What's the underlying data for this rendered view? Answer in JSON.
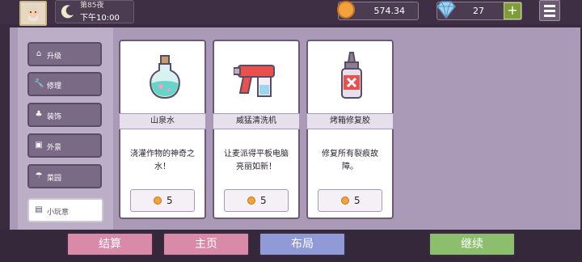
{
  "header": {
    "day_label": "第85夜",
    "time_label": "下午10:00",
    "coins": "574.34",
    "gems": "27",
    "plus_label": "+",
    "avatar_icon": "elder-portrait",
    "moon_icon": "crescent-moon",
    "menu_icon": "hamburger-menu"
  },
  "sidebar": {
    "items": [
      {
        "label": "升级",
        "icon": "home-icon"
      },
      {
        "label": "修理",
        "icon": "wrench-icon"
      },
      {
        "label": "装饰",
        "icon": "plant-icon"
      },
      {
        "label": "外景",
        "icon": "picture-icon"
      },
      {
        "label": "菜园",
        "icon": "watering-can-icon"
      },
      {
        "label": "小玩意",
        "icon": "toolbox-icon"
      }
    ],
    "active_index": 5
  },
  "cards": [
    {
      "name": "山泉水",
      "description": "浇灌作物的神奇之水！",
      "price": "5",
      "icon": "potion-bottle"
    },
    {
      "name": "威猛清洗机",
      "description": "让麦派得平板电脑亮丽如新！",
      "price": "5",
      "icon": "spray-gun"
    },
    {
      "name": "烤箱修复胶",
      "description": "修复所有裂痕故障。",
      "price": "5",
      "icon": "glue-bottle"
    }
  ],
  "buttons": {
    "checkout": "结算",
    "home": "主页",
    "layout": "布局",
    "continue": "继续"
  },
  "colors": {
    "checkout_bg": "#d98aa6",
    "home_bg": "#d98aa6",
    "layout_bg": "#8f9ad6",
    "continue_bg": "#8bbf6e"
  }
}
